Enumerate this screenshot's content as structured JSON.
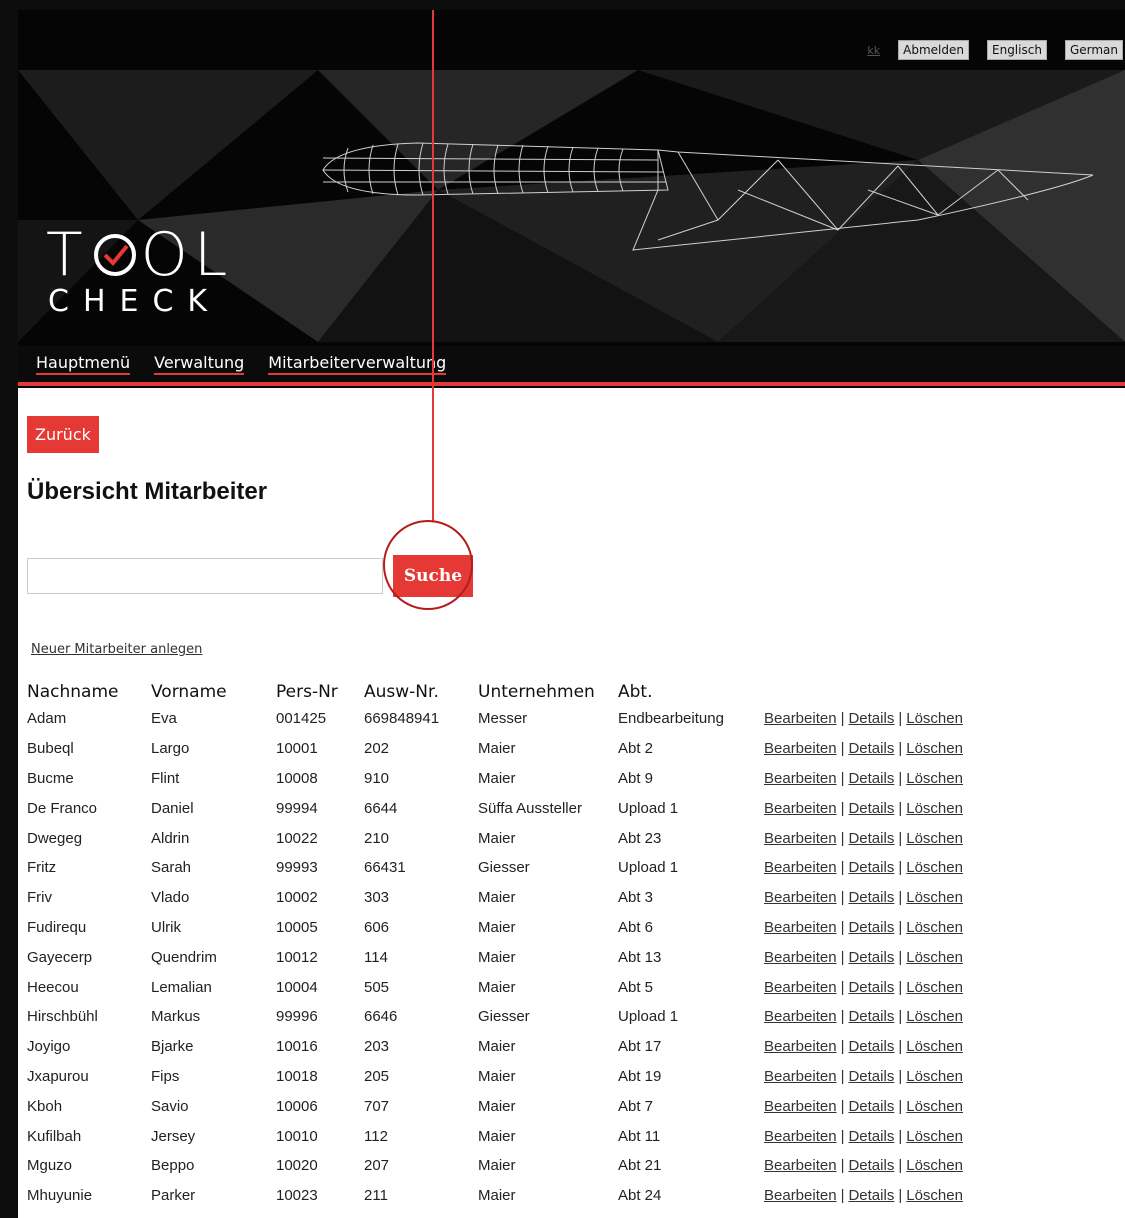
{
  "topbar": {
    "user": "kk",
    "logout": "Abmelden",
    "english": "Englisch",
    "german": "German"
  },
  "logo": {
    "line1_a": "T",
    "line1_b": "OL",
    "line2": "CHECK"
  },
  "nav": [
    "Hauptmenü",
    "Verwaltung",
    "Mitarbeiterverwaltung"
  ],
  "back_label": "Zurück",
  "title": "Übersicht Mitarbeiter",
  "search": {
    "value": "",
    "button": "Suche"
  },
  "new_link": "Neuer Mitarbeiter anlegen",
  "columns": [
    "Nachname",
    "Vorname",
    "Pers-Nr",
    "Ausw-Nr.",
    "Unternehmen",
    "Abt."
  ],
  "actions": {
    "edit": "Bearbeiten",
    "details": "Details",
    "delete": "Löschen",
    "separator": "|"
  },
  "rows": [
    [
      "Adam",
      "Eva",
      "001425",
      "669848941",
      "Messer",
      "Endbearbeitung"
    ],
    [
      "Bubeql",
      "Largo",
      "10001",
      "202",
      "Maier",
      "Abt 2"
    ],
    [
      "Bucme",
      "Flint",
      "10008",
      "910",
      "Maier",
      "Abt 9"
    ],
    [
      "De Franco",
      "Daniel",
      "99994",
      "6644",
      "Süffa Aussteller",
      "Upload 1"
    ],
    [
      "Dwegeg",
      "Aldrin",
      "10022",
      "210",
      "Maier",
      "Abt 23"
    ],
    [
      "Fritz",
      "Sarah",
      "99993",
      "66431",
      "Giesser",
      "Upload 1"
    ],
    [
      "Friv",
      "Vlado",
      "10002",
      "303",
      "Maier",
      "Abt 3"
    ],
    [
      "Fudirequ",
      "Ulrik",
      "10005",
      "606",
      "Maier",
      "Abt 6"
    ],
    [
      "Gayecerp",
      "Quendrim",
      "10012",
      "114",
      "Maier",
      "Abt 13"
    ],
    [
      "Heecou",
      "Lemalian",
      "10004",
      "505",
      "Maier",
      "Abt 5"
    ],
    [
      "Hirschbühl",
      "Markus",
      "99996",
      "6646",
      "Giesser",
      "Upload 1"
    ],
    [
      "Joyigo",
      "Bjarke",
      "10016",
      "203",
      "Maier",
      "Abt 17"
    ],
    [
      "Jxapurou",
      "Fips",
      "10018",
      "205",
      "Maier",
      "Abt 19"
    ],
    [
      "Kboh",
      "Savio",
      "10006",
      "707",
      "Maier",
      "Abt 7"
    ],
    [
      "Kufilbah",
      "Jersey",
      "10010",
      "112",
      "Maier",
      "Abt 11"
    ],
    [
      "Mguzo",
      "Beppo",
      "10020",
      "207",
      "Maier",
      "Abt 21"
    ],
    [
      "Mhuyunie",
      "Parker",
      "10023",
      "211",
      "Maier",
      "Abt 24"
    ]
  ],
  "colors": {
    "accent": "#e53935",
    "header_bg": "#050505"
  }
}
